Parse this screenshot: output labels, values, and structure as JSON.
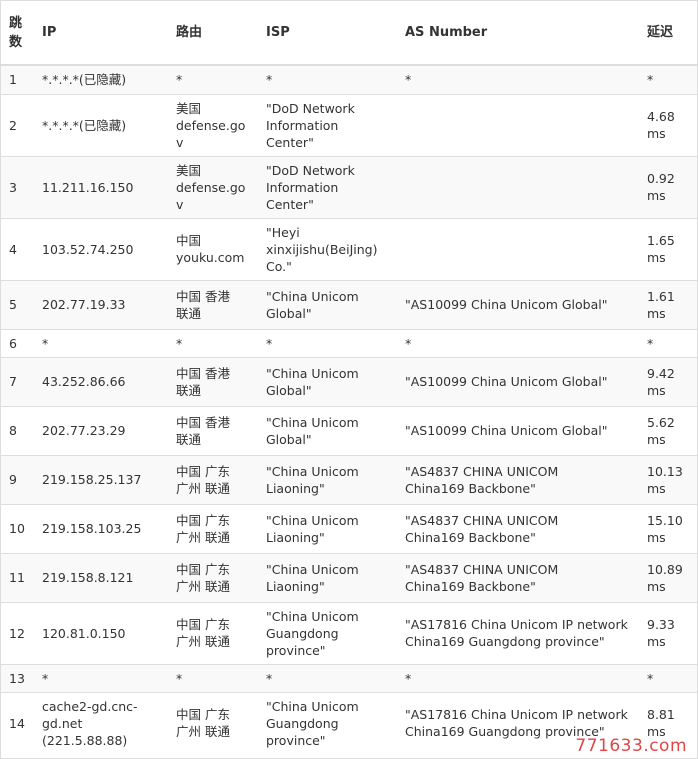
{
  "columns": {
    "hop": "跳\n数",
    "ip": "IP",
    "route": "路由",
    "isp": "ISP",
    "as": "AS Number",
    "latency": "延迟"
  },
  "rows": [
    {
      "hop": "1",
      "ip": "*.*.*.*(已隐藏)",
      "route": "*",
      "isp": "*",
      "as": "*",
      "latency": "*"
    },
    {
      "hop": "2",
      "ip": "*.*.*.*(已隐藏)",
      "route": "美国\ndefense.gov",
      "isp": "\"DoD Network\nInformation\nCenter\"",
      "as": "",
      "latency": "4.68\nms"
    },
    {
      "hop": "3",
      "ip": "11.211.16.150",
      "route": "美国\ndefense.gov",
      "isp": "\"DoD Network\nInformation\nCenter\"",
      "as": "",
      "latency": "0.92\nms"
    },
    {
      "hop": "4",
      "ip": "103.52.74.250",
      "route": "中国\nyouku.com",
      "isp": "\"Heyi\nxinxijishu(BeiJing)\nCo.\"",
      "as": "",
      "latency": "1.65\nms"
    },
    {
      "hop": "5",
      "ip": "202.77.19.33",
      "route": "中国 香港\n联通",
      "isp": "\"China Unicom\nGlobal\"",
      "as": "\"AS10099 China Unicom Global\"",
      "latency": "1.61\nms"
    },
    {
      "hop": "6",
      "ip": "*",
      "route": "*",
      "isp": "*",
      "as": "*",
      "latency": "*"
    },
    {
      "hop": "7",
      "ip": "43.252.86.66",
      "route": "中国 香港\n联通",
      "isp": "\"China Unicom\nGlobal\"",
      "as": "\"AS10099 China Unicom Global\"",
      "latency": "9.42\nms"
    },
    {
      "hop": "8",
      "ip": "202.77.23.29",
      "route": "中国 香港\n联通",
      "isp": "\"China Unicom\nGlobal\"",
      "as": "\"AS10099 China Unicom Global\"",
      "latency": "5.62\nms"
    },
    {
      "hop": "9",
      "ip": "219.158.25.137",
      "route": "中国 广东\n广州 联通",
      "isp": "\"China Unicom\nLiaoning\"",
      "as": "\"AS4837 CHINA UNICOM\nChina169 Backbone\"",
      "latency": "10.13\nms"
    },
    {
      "hop": "10",
      "ip": "219.158.103.25",
      "route": "中国 广东\n广州 联通",
      "isp": "\"China Unicom\nLiaoning\"",
      "as": "\"AS4837 CHINA UNICOM\nChina169 Backbone\"",
      "latency": "15.10\nms"
    },
    {
      "hop": "11",
      "ip": "219.158.8.121",
      "route": "中国 广东\n广州 联通",
      "isp": "\"China Unicom\nLiaoning\"",
      "as": "\"AS4837 CHINA UNICOM\nChina169 Backbone\"",
      "latency": "10.89\nms"
    },
    {
      "hop": "12",
      "ip": "120.81.0.150",
      "route": "中国 广东\n广州 联通",
      "isp": "\"China Unicom\nGuangdong\nprovince\"",
      "as": "\"AS17816 China Unicom IP network\nChina169 Guangdong province\"",
      "latency": "9.33\nms"
    },
    {
      "hop": "13",
      "ip": "*",
      "route": "*",
      "isp": "*",
      "as": "*",
      "latency": "*"
    },
    {
      "hop": "14",
      "ip": "cache2-gd.cnc-\ngd.net\n(221.5.88.88)",
      "route": "中国 广东\n广州 联通",
      "isp": "\"China Unicom\nGuangdong\nprovince\"",
      "as": "\"AS17816 China Unicom IP network\nChina169 Guangdong province\"",
      "latency": "8.81\nms"
    }
  ],
  "watermark": "771633.com"
}
